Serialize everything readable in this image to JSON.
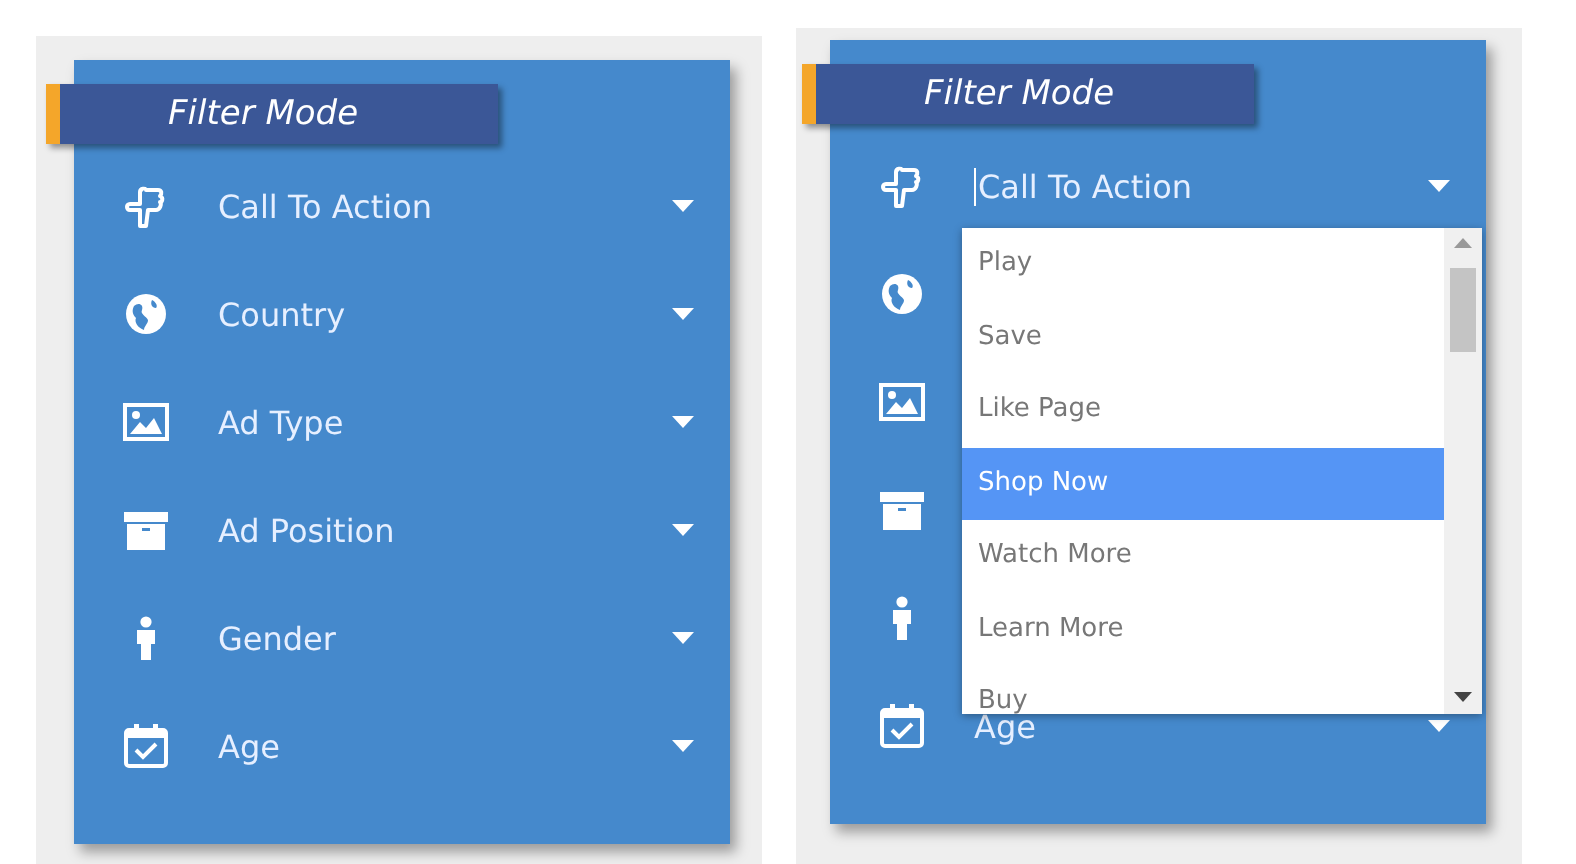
{
  "panels": [
    {
      "title": "Filter Mode",
      "filters": [
        {
          "kind": "select",
          "label": "Call To Action",
          "focused": false
        },
        {
          "kind": "select",
          "label": "Country",
          "focused": false
        },
        {
          "kind": "select",
          "label": "Ad Type",
          "focused": false
        },
        {
          "kind": "select",
          "label": "Ad Position",
          "focused": false
        },
        {
          "kind": "select",
          "label": "Gender",
          "focused": false
        },
        {
          "kind": "select",
          "label": "Age",
          "focused": false
        }
      ]
    },
    {
      "title": "Filter Mode",
      "filters": [
        {
          "kind": "select",
          "label": "Call To Action",
          "focused": true
        },
        {
          "kind": "icon_only"
        },
        {
          "kind": "icon_only"
        },
        {
          "kind": "icon_only"
        },
        {
          "kind": "icon_only"
        },
        {
          "kind": "select",
          "label": "Age",
          "focused": false
        }
      ],
      "dropdown": {
        "options": [
          {
            "label": "Play",
            "selected": false
          },
          {
            "label": "Save",
            "selected": false
          },
          {
            "label": "Like Page",
            "selected": false
          },
          {
            "label": "Shop Now",
            "selected": true
          },
          {
            "label": "Watch More",
            "selected": false
          },
          {
            "label": "Learn More",
            "selected": false
          },
          {
            "label": "Buy",
            "selected": false
          }
        ]
      }
    }
  ]
}
